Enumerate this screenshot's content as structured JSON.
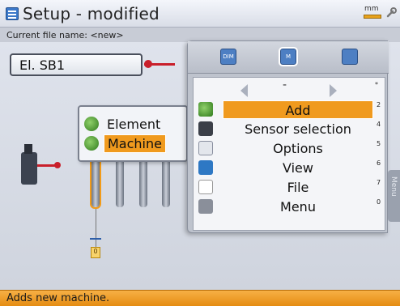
{
  "title": "Setup - modified",
  "unit_label": "mm",
  "file_line": "Current file name: <new>",
  "element_field": "El. SB1",
  "popup": {
    "items": [
      {
        "label": "Element",
        "icon": "element-icon",
        "active": false
      },
      {
        "label": "Machine",
        "icon": "machine-icon",
        "active": true
      }
    ]
  },
  "panel": {
    "tabs": [
      {
        "label": "DIM",
        "icon": "dimensions-icon"
      },
      {
        "label": "M",
        "icon": "measure-icon"
      },
      {
        "label": "",
        "icon": "results-icon"
      }
    ],
    "nav_label": "-",
    "nav_key": "*",
    "menu": [
      {
        "label": "Add",
        "key": "2",
        "icon": "add-machine-icon",
        "active": true
      },
      {
        "label": "Sensor selection",
        "key": "4",
        "icon": "sensor-icon",
        "active": false
      },
      {
        "label": "Options",
        "key": "5",
        "icon": "options-icon",
        "active": false
      },
      {
        "label": "View",
        "key": "6",
        "icon": "view-icon",
        "active": false
      },
      {
        "label": "File",
        "key": "7",
        "icon": "file-icon",
        "active": false
      },
      {
        "label": "Menu",
        "key": "0",
        "icon": "menu-icon",
        "active": false
      }
    ],
    "side_tab": "Menu"
  },
  "status": "Adds new machine.",
  "marker_label": "0",
  "colors": {
    "accent": "#f09a1e",
    "status_bar": "#e58c12",
    "pointer": "#c91f2a"
  }
}
